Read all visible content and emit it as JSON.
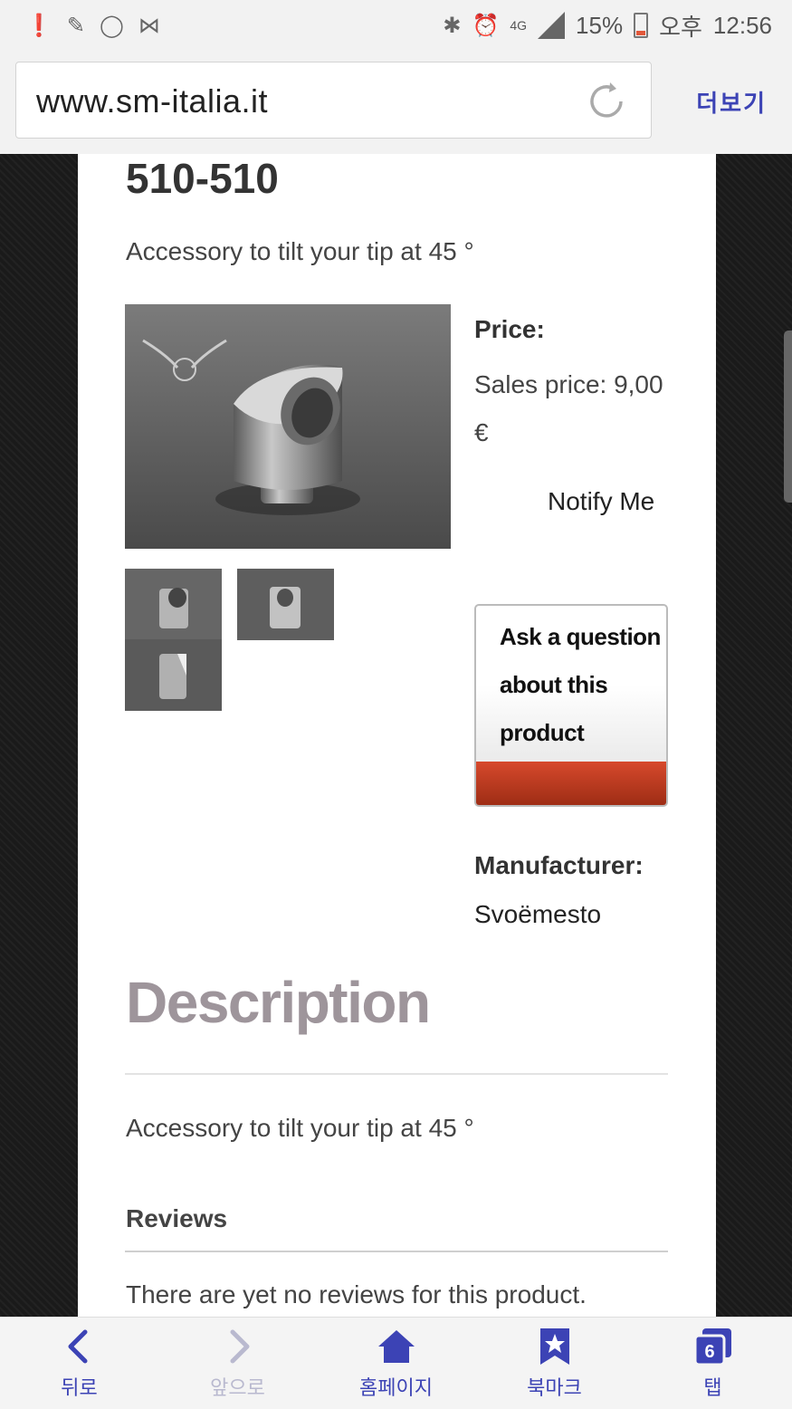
{
  "status_bar": {
    "battery": "15%",
    "time_period": "오후",
    "time": "12:56",
    "network": "4G"
  },
  "browser": {
    "url": "www.sm-italia.it",
    "more_label": "더보기"
  },
  "product": {
    "sku": "510-510",
    "short_description": "Accessory to tilt your tip at 45 °",
    "price_label": "Price:",
    "sales_price": "Sales price: 9,00 €",
    "notify_label": "Notify Me",
    "ask_question_label": "Ask a question about this product",
    "manufacturer_label": "Manufacturer:",
    "manufacturer_value": "Svoëmesto"
  },
  "description": {
    "heading": "Description",
    "text": "Accessory to tilt your tip at 45 °"
  },
  "reviews": {
    "heading": "Reviews",
    "empty_text": "There are yet no reviews for this product."
  },
  "bottom_nav": {
    "items": [
      {
        "label": "뒤로",
        "icon": "back-chevron-icon",
        "enabled": true
      },
      {
        "label": "앞으로",
        "icon": "forward-chevron-icon",
        "enabled": false
      },
      {
        "label": "홈페이지",
        "icon": "home-icon",
        "enabled": true
      },
      {
        "label": "북마크",
        "icon": "bookmark-icon",
        "enabled": true
      },
      {
        "label": "탭",
        "icon": "tabs-icon",
        "enabled": true,
        "badge": "6"
      }
    ]
  },
  "colors": {
    "accent": "#3c43b5",
    "button_red": "#c23b1f",
    "heading_gray": "#9e959b"
  }
}
